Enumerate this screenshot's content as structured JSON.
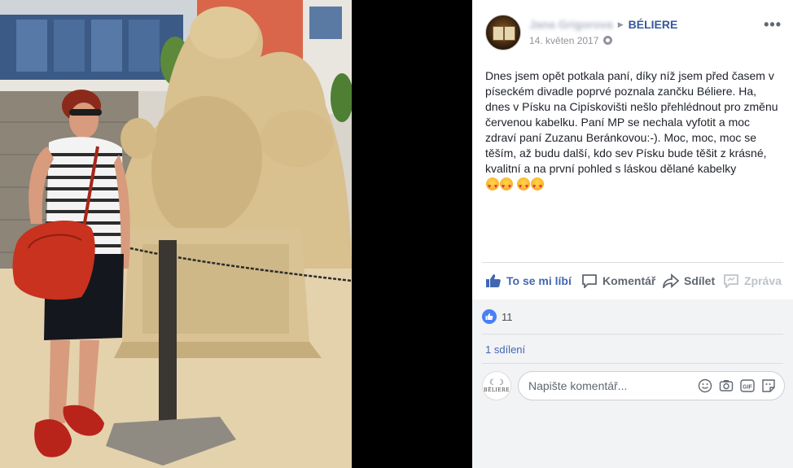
{
  "post": {
    "author_name": "Jana Grigorova",
    "page_name": "BÉLIERE",
    "date": "14. květen 2017",
    "more_label": "•••",
    "text": "Dnes jsem opět potkala paní, díky níž jsem před časem v píseckém divadle poprvé poznala zančku Béliere. Ha, dnes v Písku na Cipískovišti nešlo přehlédnout pro změnu červenou kabelku. Paní MP se nechala vyfotit a moc zdraví paní Zuzanu Beránkovou:-). Moc, moc, moc se těším, až budu další, kdo sev Písku bude těšit z krásné, kvalitní a na první pohled s láskou dělané kabelky",
    "emoji": "heart-eyes-emoji"
  },
  "actions": {
    "like": "To se mi líbí",
    "comment": "Komentář",
    "share": "Sdílet",
    "message": "Zpráva"
  },
  "stats": {
    "likes": "11",
    "shares": "1 sdílení"
  },
  "comment_box": {
    "placeholder": "Napište komentář...",
    "avatar_brand": "BĚLIERE"
  },
  "colors": {
    "link": "#365899",
    "like_blue": "#4267b2",
    "bag_red": "#c8321f"
  }
}
